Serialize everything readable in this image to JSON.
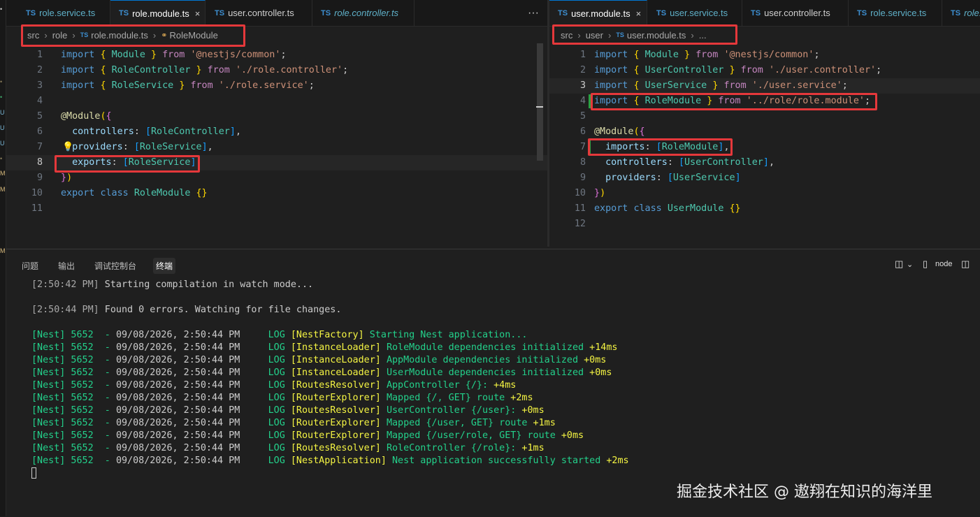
{
  "activity_markers": [
    "•",
    "•",
    "•",
    "•",
    "U",
    "U",
    "U",
    "•",
    "M",
    "M",
    "M"
  ],
  "left": {
    "tabs": [
      {
        "label": "role.service.ts",
        "style": "normal"
      },
      {
        "label": "role.module.ts",
        "style": "active"
      },
      {
        "label": "user.controller.ts",
        "style": "white"
      },
      {
        "label": "role.controller.ts",
        "style": "italic"
      }
    ],
    "more": "···",
    "close": "×",
    "ts_badge": "TS",
    "breadcrumbs": [
      "src",
      "role",
      "role.module.ts",
      "RoleModule"
    ],
    "line_numbers": [
      "1",
      "2",
      "3",
      "4",
      "5",
      "6",
      "7",
      "8",
      "9",
      "10",
      "11"
    ],
    "current_line": "8"
  },
  "right": {
    "tabs": [
      {
        "label": "user.module.ts",
        "style": "active"
      },
      {
        "label": "user.service.ts",
        "style": "normal"
      },
      {
        "label": "user.controller.ts",
        "style": "white"
      },
      {
        "label": "role.service.ts",
        "style": "normal"
      },
      {
        "label": "role.",
        "style": "italic"
      }
    ],
    "breadcrumbs": [
      "src",
      "user",
      "user.module.ts",
      "..."
    ],
    "line_numbers": [
      "1",
      "2",
      "3",
      "4",
      "5",
      "6",
      "7",
      "8",
      "9",
      "10",
      "11",
      "12"
    ],
    "current_line": "3"
  },
  "panel": {
    "tabs": [
      "问题",
      "输出",
      "调试控制台",
      "终端"
    ],
    "active_tab": "终端",
    "shell_label": "node",
    "lines": [
      {
        "ts": "[2:50:42 PM]",
        "msg": " Starting compilation in watch mode..."
      },
      {
        "ts": "[2:50:44 PM]",
        "msg": " Found 0 errors. Watching for file changes."
      }
    ],
    "nest_prefix": "[Nest] 5652  - ",
    "nest_date": "09/08/2026, 2:50:44 PM",
    "log_level": "LOG",
    "logs": [
      {
        "ctx": "[NestFactory]",
        "msg": "Starting Nest application...",
        "time": ""
      },
      {
        "ctx": "[InstanceLoader]",
        "msg": "RoleModule dependencies initialized",
        "time": "+14ms"
      },
      {
        "ctx": "[InstanceLoader]",
        "msg": "AppModule dependencies initialized",
        "time": "+0ms"
      },
      {
        "ctx": "[InstanceLoader]",
        "msg": "UserModule dependencies initialized",
        "time": "+0ms"
      },
      {
        "ctx": "[RoutesResolver]",
        "msg": "AppController {/}:",
        "time": "+4ms"
      },
      {
        "ctx": "[RouterExplorer]",
        "msg": "Mapped {/, GET} route",
        "time": "+2ms"
      },
      {
        "ctx": "[RoutesResolver]",
        "msg": "UserController {/user}:",
        "time": "+0ms"
      },
      {
        "ctx": "[RouterExplorer]",
        "msg": "Mapped {/user, GET} route",
        "time": "+1ms"
      },
      {
        "ctx": "[RouterExplorer]",
        "msg": "Mapped {/user/role, GET} route",
        "time": "+0ms"
      },
      {
        "ctx": "[RoutesResolver]",
        "msg": "RoleController {/role}:",
        "time": "+1ms"
      },
      {
        "ctx": "[NestApplication]",
        "msg": "Nest application successfully started",
        "time": "+2ms"
      }
    ]
  },
  "watermark": "掘金技术社区 @ 遨翔在知识的海洋里"
}
